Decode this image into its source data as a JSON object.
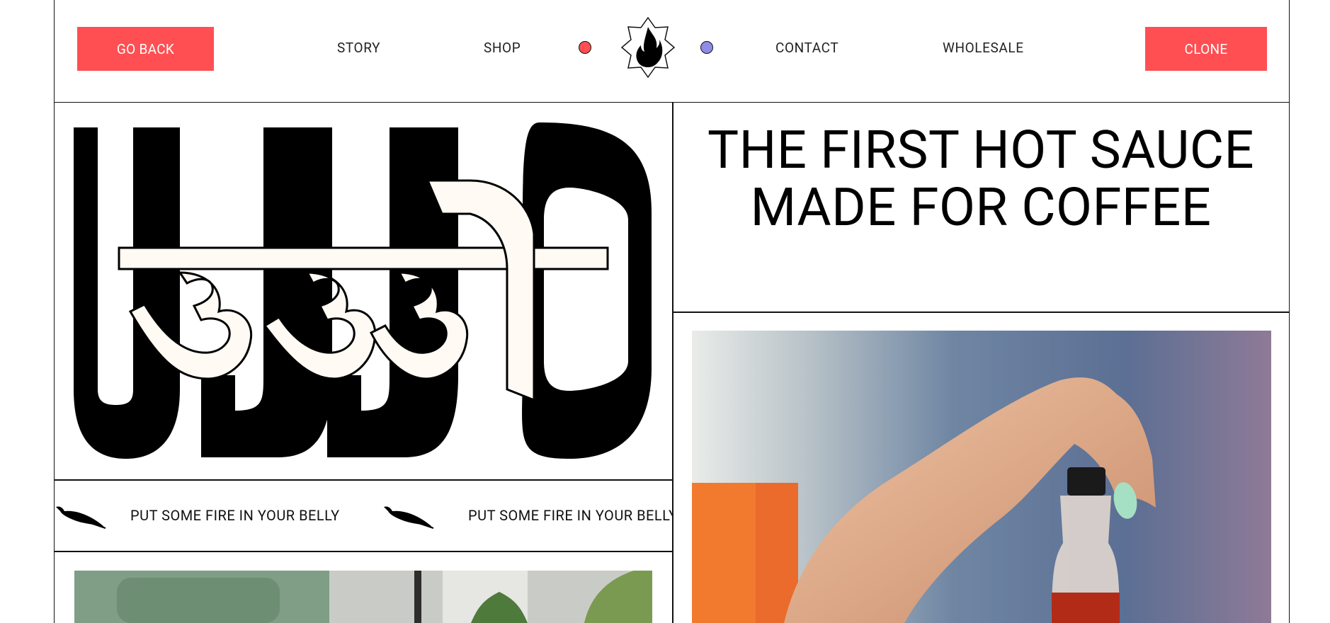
{
  "header": {
    "go_back": "GO BACK",
    "clone": "CLONE",
    "nav": [
      "STORY",
      "SHOP",
      "CONTACT",
      "WHOLESALE"
    ],
    "logo_icon": "flame-badge-icon",
    "dot_colors": [
      "#ff4f52",
      "#8f8be8"
    ]
  },
  "brand": {
    "latin": "UJJO",
    "devanagari": "उज्जो"
  },
  "marquee": {
    "text": "PUT SOME FIRE IN YOUR BELLY",
    "icon": "chili-pepper-icon"
  },
  "hero": {
    "headline": "THE FIRST HOT SAUCE MADE FOR COFFEE"
  },
  "colors": {
    "accent": "#ff4f52",
    "ink": "#111111"
  }
}
